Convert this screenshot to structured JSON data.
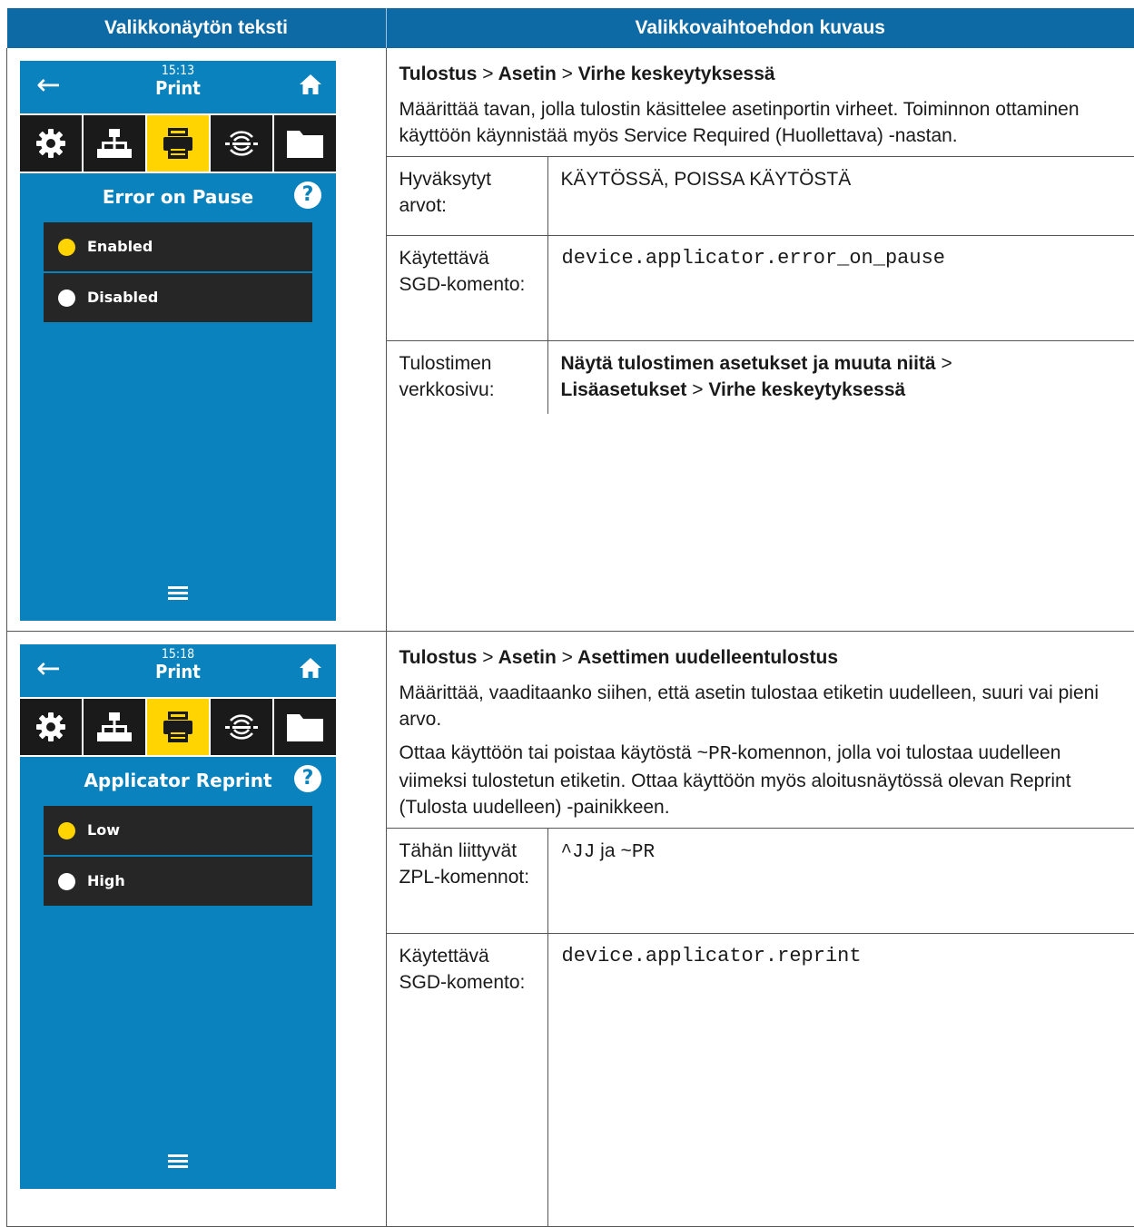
{
  "header": {
    "left": "Valikkonäytön teksti",
    "right": "Valikkovaihtoehdon kuvaus"
  },
  "rows": [
    {
      "screen": {
        "time": "15:13",
        "menu": "Print",
        "title": "Error on Pause",
        "help_glyph": "?",
        "options": [
          {
            "label": "Enabled",
            "selected": true
          },
          {
            "label": "Disabled",
            "selected": false
          }
        ]
      },
      "path": {
        "a": "Tulostus",
        "sep1": ">",
        "b": "Asetin",
        "sep2": ">",
        "c": "Virhe keskeytyksessä"
      },
      "description": "Määrittää tavan, jolla tulostin käsittelee asetinportin virheet. Toiminnon ottaminen käyttöön käynnistää myös Service Required (Huollettava) -nastan.",
      "table": {
        "accepted_label": "Hyväksytyt arvot:",
        "accepted_value": "KÄYTÖSSÄ, POISSA KÄYTÖSTÄ",
        "sgd_label": "Käytettävä SGD-komento:",
        "sgd_value": "device.applicator.error_on_pause",
        "web_label": "Tulostimen verkkosivu:",
        "web_part1": "Näytä tulostimen asetukset ja muuta niitä",
        "web_sep1": ">",
        "web_part2": "Lisäasetukset",
        "web_sep2": ">",
        "web_part3": "Virhe keskeytyksessä"
      }
    },
    {
      "screen": {
        "time": "15:18",
        "menu": "Print",
        "title": "Applicator Reprint",
        "help_glyph": "?",
        "options": [
          {
            "label": "Low",
            "selected": true
          },
          {
            "label": "High",
            "selected": false
          }
        ]
      },
      "path": {
        "a": "Tulostus",
        "sep1": ">",
        "b": "Asetin",
        "sep2": ">",
        "c": "Asettimen uudelleentulostus"
      },
      "description": "Määrittää, vaaditaanko siihen, että asetin tulostaa etiketin uudelleen, suuri vai pieni arvo.",
      "description2_pre": "Ottaa käyttöön tai poistaa käytöstä ",
      "description2_code": "~PR",
      "description2_post": "-komennon, jolla voi tulostaa uudelleen viimeksi tulostetun etiketin. Ottaa käyttöön myös aloitusnäytössä olevan Reprint (Tulosta uudelleen) -painikkeen.",
      "table": {
        "zpl_label": "Tähän liittyvät ZPL-komennot:",
        "zpl_code1": "^JJ",
        "zpl_mid": " ja ",
        "zpl_code2": "~PR",
        "sgd_label": "Käytettävä SGD-komento:",
        "sgd_value": "device.applicator.reprint"
      }
    }
  ],
  "icons": {
    "back": "back-arrow-icon",
    "home": "home-icon",
    "tabs": [
      "gear-icon",
      "network-icon",
      "printer-icon",
      "rfid-icon",
      "folder-icon"
    ],
    "menu": "hamburger-menu-icon",
    "help": "help-icon"
  },
  "colors": {
    "header_bg": "#0d6aa4",
    "screen_bg": "#0a82bd",
    "active_tab": "#ffd400",
    "option_bg": "#262626"
  }
}
